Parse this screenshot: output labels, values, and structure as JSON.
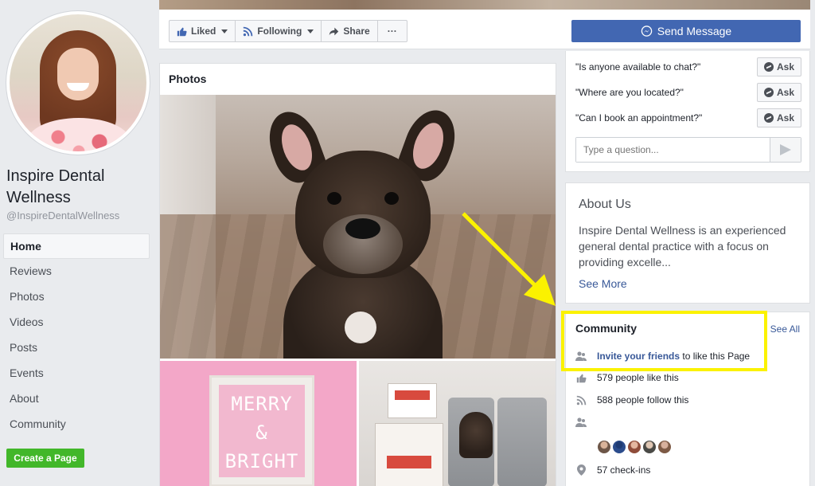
{
  "page": {
    "name": "Inspire Dental Wellness",
    "handle": "@InspireDentalWellness"
  },
  "nav": {
    "items": [
      {
        "label": "Home",
        "active": true
      },
      {
        "label": "Reviews"
      },
      {
        "label": "Photos"
      },
      {
        "label": "Videos"
      },
      {
        "label": "Posts"
      },
      {
        "label": "Events"
      },
      {
        "label": "About"
      },
      {
        "label": "Community"
      }
    ],
    "create_page_label": "Create a Page"
  },
  "actions": {
    "liked_label": "Liked",
    "following_label": "Following",
    "share_label": "Share",
    "more_label": "···",
    "send_message_label": "Send Message"
  },
  "photos": {
    "title": "Photos",
    "pink_photo_text": [
      "MERRY",
      "&",
      "BRIGHT"
    ]
  },
  "chat": {
    "questions": [
      "\"Is anyone available to chat?\"",
      "\"Where are you located?\"",
      "\"Can I book an appointment?\""
    ],
    "ask_label": "Ask",
    "input_placeholder": "Type a question..."
  },
  "about": {
    "title": "About Us",
    "description": "Inspire Dental Wellness is an experienced general dental practice with a focus on providing excelle...",
    "see_more_label": "See More"
  },
  "community": {
    "title": "Community",
    "see_all_label": "See All",
    "invite_link": "Invite your friends",
    "invite_suffix": "to like this Page",
    "likes_text": "579 people like this",
    "follows_text": "588 people follow this",
    "checkins_text": "57 check-ins"
  },
  "colors": {
    "facebook_blue": "#4267b2",
    "link_blue": "#385898",
    "green": "#42b72a",
    "annotation_yellow": "#fbf200"
  },
  "icons": {
    "liked": "thumbs-up-icon",
    "following": "rss-icon",
    "share": "share-arrow-icon",
    "messenger": "messenger-icon",
    "send": "send-icon",
    "people": "people-icon",
    "like": "thumbs-up-icon",
    "follow": "rss-icon",
    "checkin": "location-pin-icon"
  }
}
